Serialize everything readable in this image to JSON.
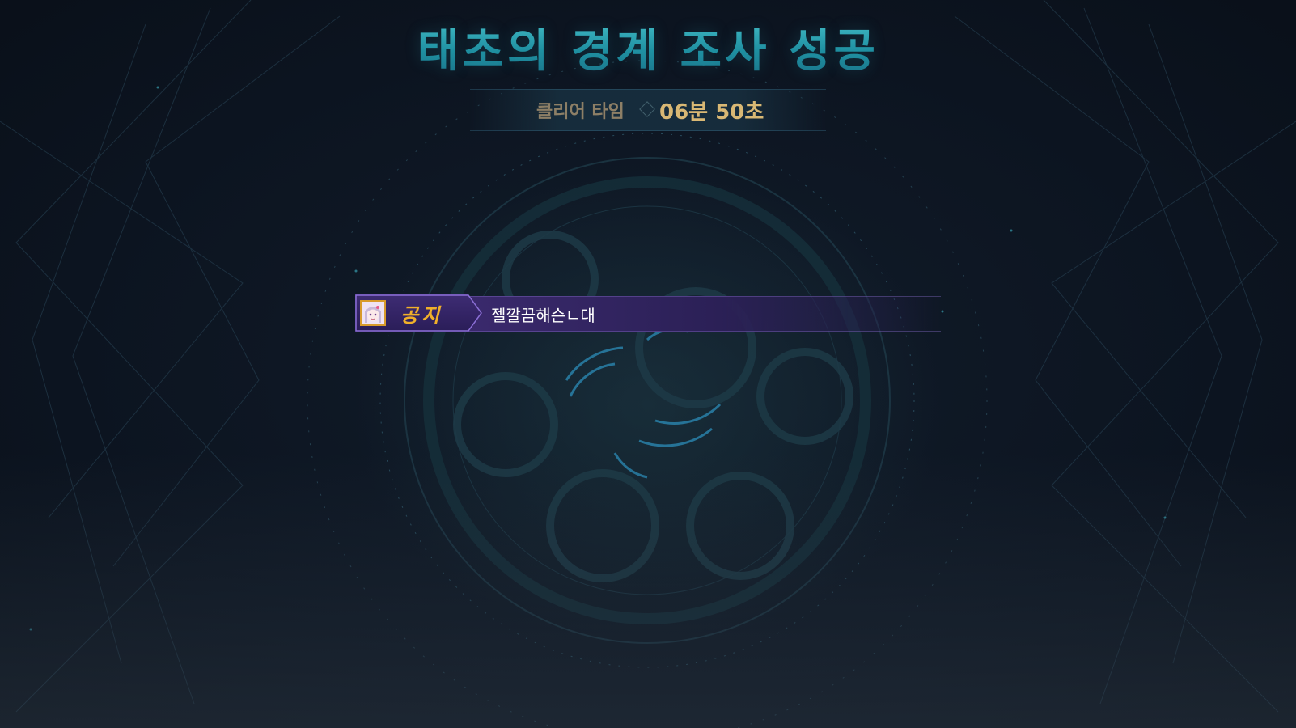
{
  "result": {
    "title": "태초의 경계 조사 성공",
    "clear_time_label": "클리어 타임",
    "clear_time_value": "06분 50초"
  },
  "notice": {
    "tag_label": "공지",
    "message": "젤깔끔해슨ㄴ대",
    "avatar_icon": "character-portrait-icon"
  },
  "colors": {
    "title": "#2fa7b3",
    "clear_time_value": "#d9b874",
    "clear_time_label": "#8d7f66",
    "notice_tag_text": "#f0b02a",
    "notice_bar": "#3b2a6e",
    "background": "#0d1520"
  }
}
